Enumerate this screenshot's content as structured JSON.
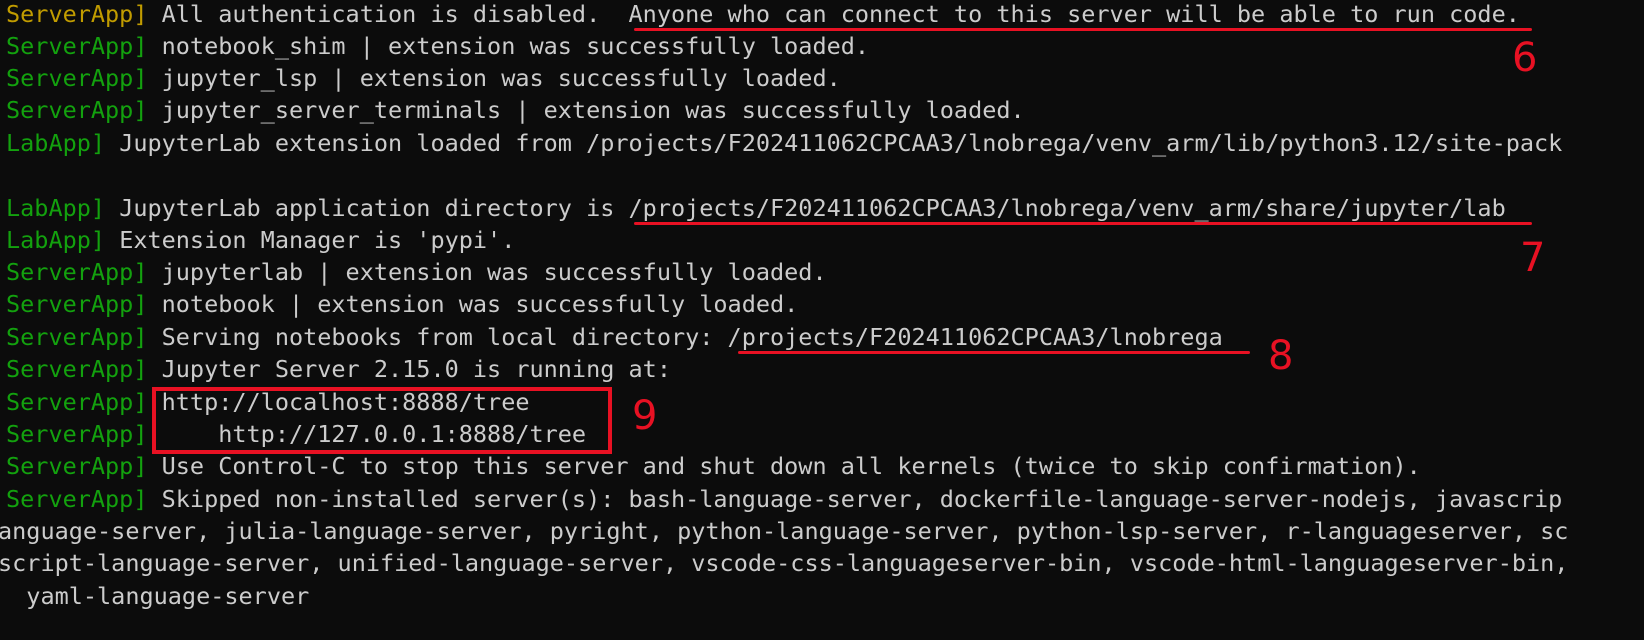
{
  "lines": [
    {
      "tag": "ServerApp]",
      "text": " All authentication is disabled.  Anyone who can connect to this server will be able to run code."
    },
    {
      "tag": "ServerApp]",
      "text": " notebook_shim | extension was successfully loaded."
    },
    {
      "tag": "ServerApp]",
      "text": " jupyter_lsp | extension was successfully loaded."
    },
    {
      "tag": "ServerApp]",
      "text": " jupyter_server_terminals | extension was successfully loaded."
    },
    {
      "tag": "LabApp]",
      "text": " JupyterLab extension loaded from /projects/F202411062CPCAA3/lnobrega/venv_arm/lib/python3.12/site-pack"
    },
    {
      "tag": "",
      "text": ""
    },
    {
      "tag": "LabApp]",
      "text": " JupyterLab application directory is /projects/F202411062CPCAA3/lnobrega/venv_arm/share/jupyter/lab"
    },
    {
      "tag": "LabApp]",
      "text": " Extension Manager is 'pypi'."
    },
    {
      "tag": "ServerApp]",
      "text": " jupyterlab | extension was successfully loaded."
    },
    {
      "tag": "ServerApp]",
      "text": " notebook | extension was successfully loaded."
    },
    {
      "tag": "ServerApp]",
      "text": " Serving notebooks from local directory: /projects/F202411062CPCAA3/lnobrega"
    },
    {
      "tag": "ServerApp]",
      "text": " Jupyter Server 2.15.0 is running at:"
    },
    {
      "tag": "ServerApp]",
      "text": " http://localhost:8888/tree"
    },
    {
      "tag": "ServerApp]",
      "text": "     http://127.0.0.1:8888/tree"
    },
    {
      "tag": "ServerApp]",
      "text": " Use Control-C to stop this server and shut down all kernels (twice to skip confirmation)."
    },
    {
      "tag": "ServerApp]",
      "text": " Skipped non-installed server(s): bash-language-server, dockerfile-language-server-nodejs, javascrip"
    },
    {
      "tag": "",
      "text": "anguage-server, julia-language-server, pyright, python-language-server, python-lsp-server, r-languageserver, sc"
    },
    {
      "tag": "",
      "text": "script-language-server, unified-language-server, vscode-css-languageserver-bin, vscode-html-languageserver-bin,"
    },
    {
      "tag": "",
      "text": "  yaml-language-server"
    }
  ],
  "annotations": {
    "n6": "6",
    "n7": "7",
    "n8": "8",
    "n9": "9"
  },
  "colors": {
    "background": "#0c0c0c",
    "text": "#cccccc",
    "tag": "#13a10e",
    "tag_first": "#c19c00",
    "annotation": "#e81123"
  }
}
